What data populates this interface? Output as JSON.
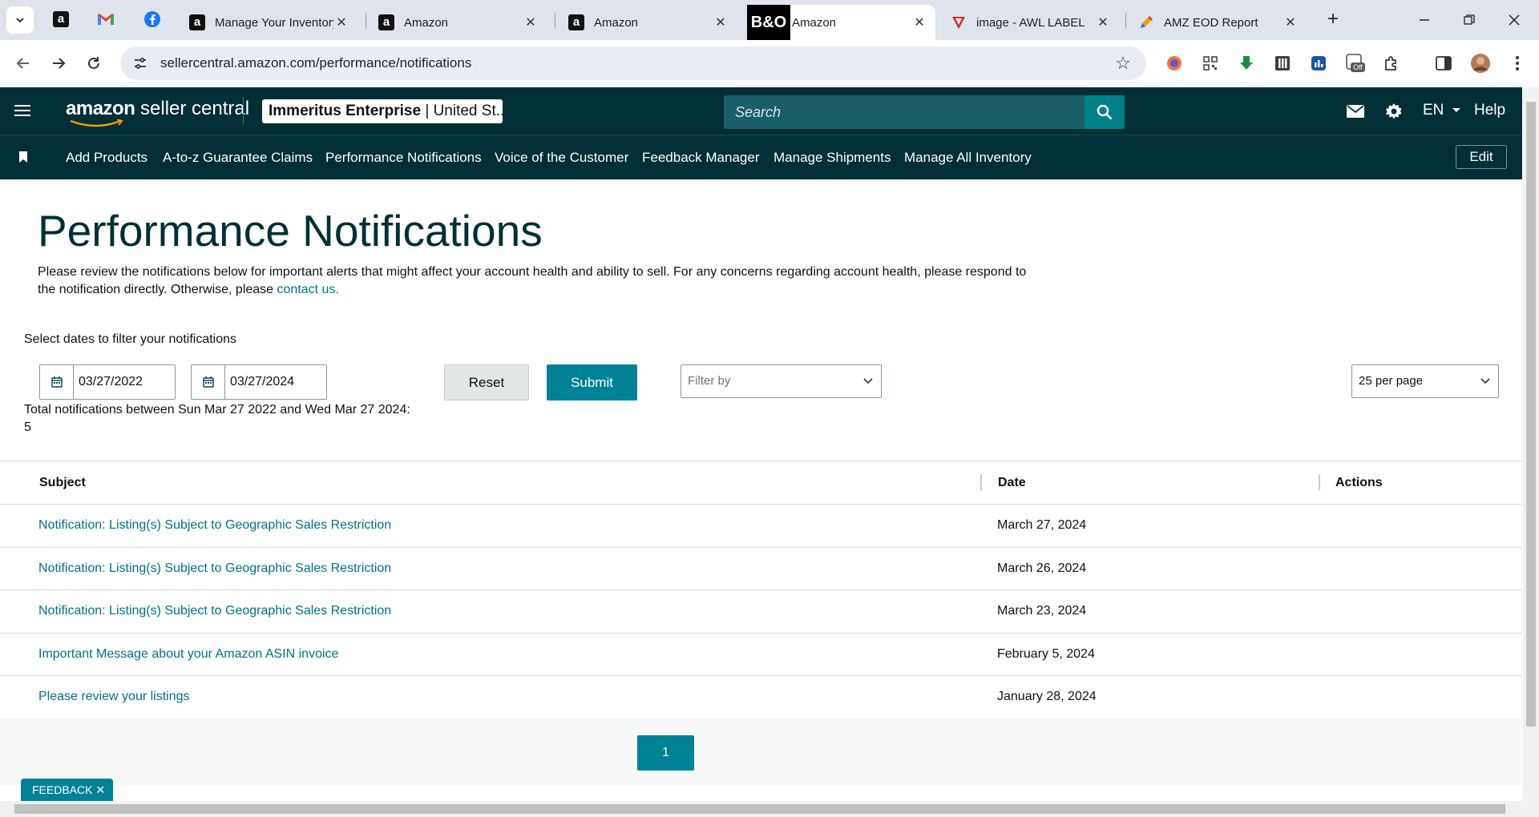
{
  "browser": {
    "tabs": [
      {
        "title": "Manage Your Inventory",
        "favicon": "amazon-icon"
      },
      {
        "title": "Amazon",
        "favicon": "amazon-icon"
      },
      {
        "title": "Amazon",
        "favicon": "amazon-icon"
      },
      {
        "title": "Amazon",
        "favicon": "amazon-icon",
        "active": true
      },
      {
        "title": "image - AWL LABEL",
        "favicon": "red-arrow-icon"
      },
      {
        "title": "AMZ EOD Report",
        "favicon": "pen-icon"
      }
    ],
    "pinned": [
      "amazon-icon",
      "gmail-icon",
      "facebook-icon"
    ],
    "url": "sellercentral.amazon.com/performance/notifications",
    "overlay_badge": "B&O"
  },
  "header": {
    "logo_brand": "amazon",
    "logo_suffix": " seller central",
    "account_name": "Immeritus Enterprise",
    "account_region": " | United St...",
    "search_placeholder": "Search",
    "language": "EN",
    "help": "Help"
  },
  "nav": {
    "links": [
      "Add Products",
      "A-to-z Guarantee Claims",
      "Performance Notifications",
      "Voice of the Customer",
      "Feedback Manager",
      "Manage Shipments",
      "Manage All Inventory"
    ],
    "edit": "Edit"
  },
  "page": {
    "title": "Performance Notifications",
    "intro": "Please review the notifications below for important alerts that might affect your account health and ability to sell. For any concerns regarding account health, please respond to the notification directly. Otherwise, please ",
    "intro_link": "contact us.",
    "filter_label": "Select dates to filter your notifications",
    "start_date": "03/27/2022",
    "end_date": "03/27/2024",
    "reset": "Reset",
    "submit": "Submit",
    "filter_placeholder": "Filter by",
    "per_page": "25 per page",
    "total_line": "Total notifications between Sun Mar 27 2022 and Wed Mar 27 2024:",
    "total_count": "5"
  },
  "table": {
    "headers": {
      "subject": "Subject",
      "date": "Date",
      "actions": "Actions"
    },
    "rows": [
      {
        "subject": "Notification: Listing(s) Subject to Geographic Sales Restriction",
        "date": "March 27, 2024"
      },
      {
        "subject": "Notification: Listing(s) Subject to Geographic Sales Restriction",
        "date": "March 26, 2024"
      },
      {
        "subject": "Notification: Listing(s) Subject to Geographic Sales Restriction",
        "date": "March 23, 2024"
      },
      {
        "subject": "Important Message about your Amazon ASIN invoice",
        "date": "February 5, 2024"
      },
      {
        "subject": "Please review your listings",
        "date": "January 28, 2024"
      }
    ]
  },
  "pagination": {
    "current": "1"
  },
  "feedback": {
    "label": "FEEDBACK ✕"
  },
  "colors": {
    "header_bg": "#002f36",
    "accent": "#008296",
    "link": "#007185"
  }
}
